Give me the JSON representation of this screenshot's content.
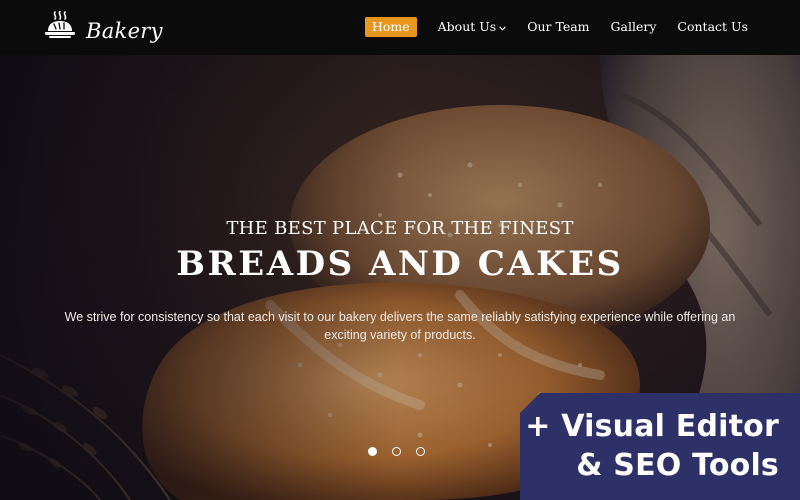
{
  "header": {
    "logo": {
      "icon": "bread-basket-icon",
      "text": "Bakery"
    },
    "nav": [
      {
        "label": "Home",
        "active": true
      },
      {
        "label": "About Us",
        "dropdown": true
      },
      {
        "label": "Our Team"
      },
      {
        "label": "Gallery"
      },
      {
        "label": "Contact Us"
      }
    ]
  },
  "hero": {
    "eyebrow": "THE BEST PLACE FOR THE FINEST",
    "headline": "BREADS AND CAKES",
    "description": "We strive for consistency so that each visit to our bakery delivers the same reliably satisfying experience while offering an exciting variety of products.",
    "slides": 3,
    "active_slide": 1
  },
  "badge": {
    "line1": "+ Visual Editor",
    "line2": "& SEO Tools"
  },
  "colors": {
    "accent": "#e9961f",
    "header_bg": "#0b0b0b",
    "badge_bg": "#2d3168"
  }
}
